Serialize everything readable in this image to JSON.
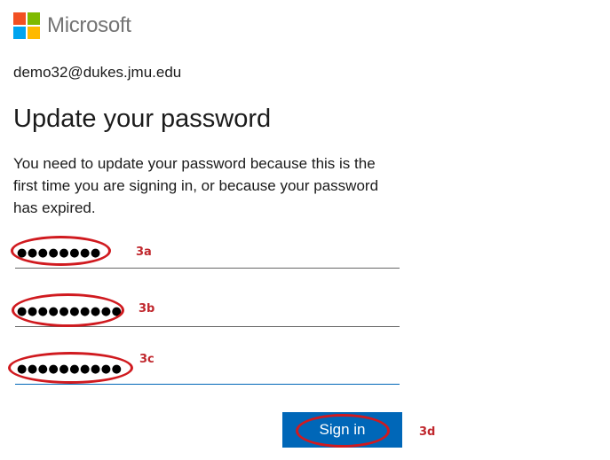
{
  "brand": {
    "name": "Microsoft",
    "logo_colors": [
      "#f25022",
      "#7fba00",
      "#00a4ef",
      "#ffb900"
    ]
  },
  "account": {
    "email": "demo32@dukes.jmu.edu"
  },
  "page": {
    "title": "Update your password",
    "description": "You need to update your password because this is the first time you are signing in, or because your password has expired."
  },
  "fields": {
    "current_password": {
      "masked_value": "●●●●●●●●"
    },
    "new_password": {
      "masked_value": "●●●●●●●●●●"
    },
    "confirm_password": {
      "masked_value": "●●●●●●●●●●"
    }
  },
  "annotations": {
    "a": "3a",
    "b": "3b",
    "c": "3c",
    "d": "3d",
    "color": "#d01a1f"
  },
  "buttons": {
    "sign_in": "Sign in"
  },
  "colors": {
    "accent": "#0067b8"
  }
}
